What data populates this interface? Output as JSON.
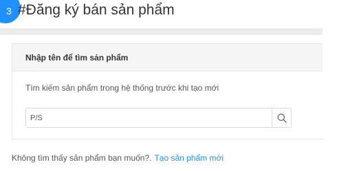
{
  "header": {
    "step_number": "3",
    "title": "#Đăng ký bán sản phẩm"
  },
  "panel": {
    "heading": "Nhập tên để tìm sản phẩm",
    "description": "Tìm kiếm sản phẩm trong hệ thống trước khi tạo mới",
    "search": {
      "value": "P/S",
      "placeholder": "",
      "icon": "search-icon"
    }
  },
  "footer": {
    "not_found_text": "Không tìm thấy sản phẩm bạn muốn?.",
    "create_link_label": "Tạo sản phẩm mới"
  },
  "colors": {
    "accent": "#1e90ff",
    "panel_header_bg": "#f5f5f5",
    "band_bg": "#ececec"
  }
}
